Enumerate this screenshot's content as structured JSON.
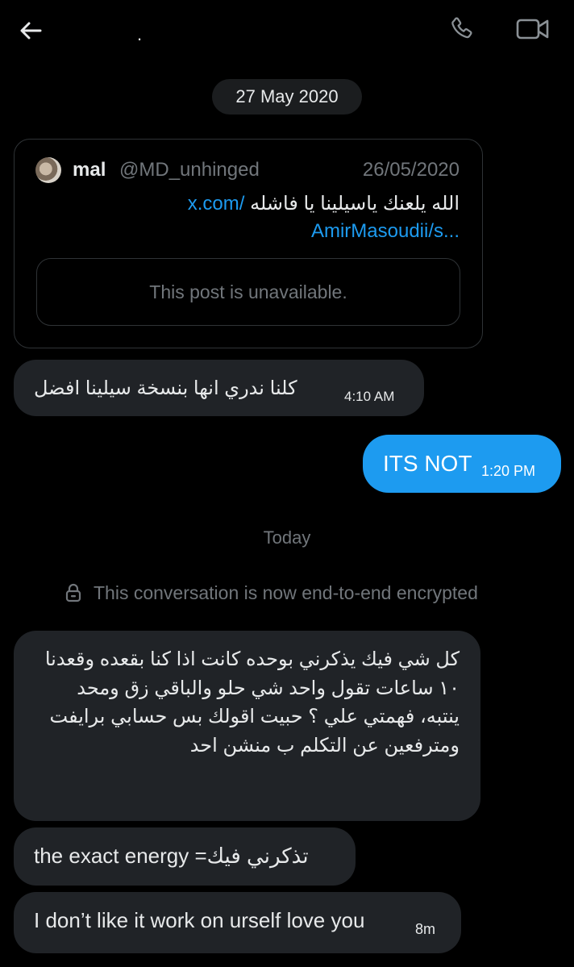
{
  "header": {
    "title": ".",
    "back_icon": "back-arrow-icon",
    "call_icon": "phone-icon",
    "video_icon": "video-camera-icon"
  },
  "date_divider_1": "27 May 2020",
  "shared_post": {
    "name": "mal",
    "handle": "@MD_unhinged",
    "date": "26/05/2020",
    "text": "الله يلعنك ياسيلينا يا فاشله",
    "link_line1": "x.com/",
    "link_line2": "AmirMasoudii/s...",
    "unavailable": "This post is unavailable."
  },
  "messages": [
    {
      "side": "in",
      "text": "كلنا ندري انها بنسخة سيلينا افضل",
      "time": "4:10 AM"
    },
    {
      "side": "out",
      "text": "ITS NOT",
      "time": "1:20 PM"
    }
  ],
  "date_divider_2": "Today",
  "encryption_notice": "This conversation is now end-to-end encrypted",
  "messages_today": [
    {
      "side": "in",
      "text": "كل شي فيك يذكرني بوحده كانت اذا كنا بقعده وقعدنا ١٠ ساعات تقول واحد شي حلو والباقي زق ومحد ينتبه، فهمتي علي ؟ حبيت اقولك بس حسابي برايفت ومترفعين عن التكلم ب منشن احد"
    },
    {
      "side": "in",
      "text": "the exact energy =تذكرني فيك"
    },
    {
      "side": "in",
      "text": "I don’t like it work on urself love you",
      "time": "8m"
    }
  ],
  "colors": {
    "background": "#000000",
    "bubble_in": "#202327",
    "bubble_out": "#1d9bf0",
    "muted_text": "#71767b",
    "link": "#1d9bf0"
  }
}
